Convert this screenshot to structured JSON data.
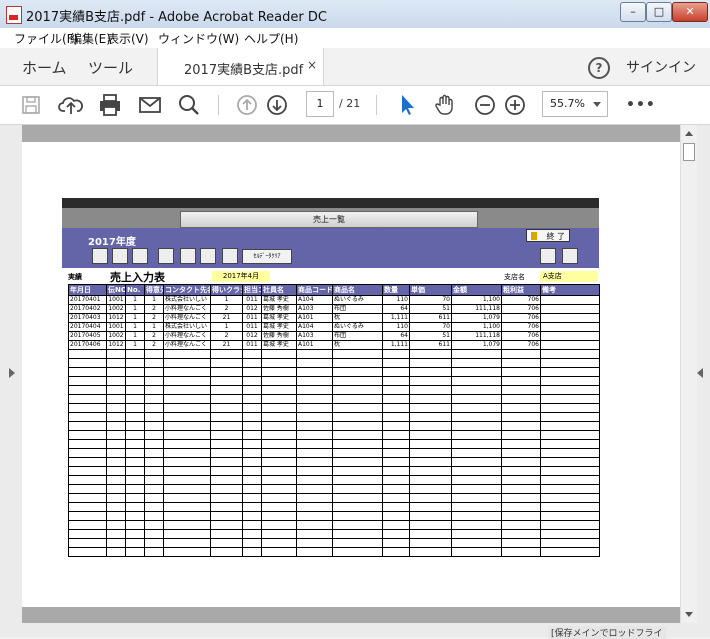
{
  "window": {
    "title": "2017実績B支店.pdf - Adobe Acrobat Reader DC",
    "btn_min": "–",
    "btn_max": "□",
    "btn_close": "✕"
  },
  "menu": [
    "ファイル(F)",
    "編集(E)",
    "表示(V)",
    "ウィンドウ(W)",
    "ヘルプ(H)"
  ],
  "tabs": {
    "home": "ホーム",
    "tools": "ツール",
    "doc": "2017実績B支店.pdf",
    "close": "×",
    "help": "?",
    "signin": "サインイン"
  },
  "toolbar": {
    "page_current": "1",
    "page_total": "/ 21",
    "zoom": "55.7%",
    "more": "•••"
  },
  "form": {
    "title_button": "売上一覧",
    "year": "2017年度",
    "end_button": "終 了",
    "cell_clear_button": "ｾﾙﾃﾞｰﾀｸﾘｱ",
    "small_label": "実績",
    "big_label": "売上入力表",
    "month": "2017年4月",
    "branch_label": "支店名",
    "branch_value": "A支店",
    "headers": [
      "年月日",
      "伝NO",
      "No.",
      "得意先コード",
      "コンタクト先名",
      "得いクラシフ",
      "担当コード",
      "社員名",
      "商品コード",
      "商品名",
      "数量",
      "単価",
      "金額",
      "粗利益",
      "備考"
    ],
    "rows": [
      [
        "20170401",
        "1001",
        "1",
        "1",
        "株式会社いしい",
        "1",
        "011",
        "葛城 孝史",
        "A104",
        "ぬいぐるみ",
        "110",
        "70",
        "1,100",
        "706",
        ""
      ],
      [
        "20170402",
        "1002",
        "1",
        "2",
        "小料理なんごく",
        "2",
        "012",
        "佐藤 秀樹",
        "A103",
        "布団",
        "64",
        "51",
        "111,118",
        "706",
        ""
      ],
      [
        "20170403",
        "1012",
        "1",
        "2",
        "小料理なんごく",
        "21",
        "011",
        "葛城 孝史",
        "A101",
        "枕",
        "1,111",
        "611",
        "1,079",
        "706",
        ""
      ],
      [
        "20170404",
        "1001",
        "1",
        "1",
        "株式会社いしい",
        "1",
        "011",
        "葛城 孝史",
        "A104",
        "ぬいぐるみ",
        "110",
        "70",
        "1,100",
        "706",
        ""
      ],
      [
        "20170405",
        "1002",
        "1",
        "2",
        "小料理なんごく",
        "2",
        "012",
        "佐藤 秀樹",
        "A103",
        "布団",
        "64",
        "51",
        "111,118",
        "706",
        ""
      ],
      [
        "20170406",
        "1012",
        "1",
        "2",
        "小料理なんごく",
        "21",
        "011",
        "葛城 孝史",
        "A101",
        "枕",
        "1,111",
        "611",
        "1,079",
        "706",
        ""
      ]
    ],
    "empty_rows": 23
  },
  "taskbar_hint": "[保存メインでロッドフライ"
}
